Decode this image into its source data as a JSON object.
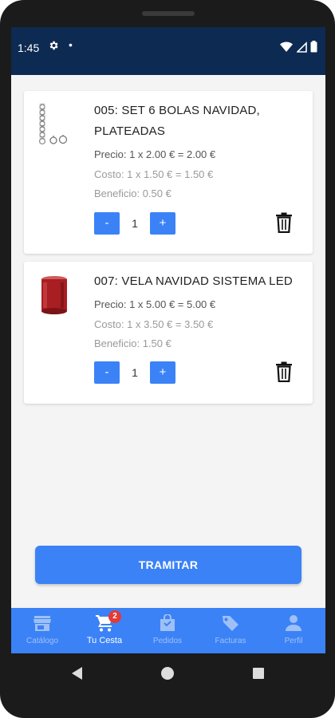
{
  "status_bar": {
    "time": "1:45",
    "settings_icon": "gear-icon",
    "notification_dot": "•",
    "wifi_icon": "wifi-icon",
    "signal_icon": "signal-icon",
    "battery_icon": "battery-icon",
    "bg_color": "#0d2a52"
  },
  "cart": {
    "items": [
      {
        "title": "005: SET 6 BOLAS NAVIDAD, PLATEADAS",
        "precio": "Precio: 1 x 2.00 € = 2.00 €",
        "costo": "Costo: 1 x 1.50 € = 1.50 €",
        "beneficio": "Beneficio: 0.50 €",
        "minus": "-",
        "quantity": "1",
        "plus": "+",
        "image_icon": "ornament-balls-image",
        "delete_icon": "trash-icon"
      },
      {
        "title": "007: VELA NAVIDAD SISTEMA LED",
        "precio": "Precio: 1 x 5.00 € = 5.00 €",
        "costo": "Costo: 1 x 3.50 € = 3.50 €",
        "beneficio": "Beneficio: 1.50 €",
        "minus": "-",
        "quantity": "1",
        "plus": "+",
        "image_icon": "red-candle-image",
        "delete_icon": "trash-icon"
      }
    ],
    "checkout_label": "TRAMITAR"
  },
  "bottom_nav": {
    "items": [
      {
        "label": "Catálogo",
        "icon": "store-icon",
        "active": false
      },
      {
        "label": "Tu Cesta",
        "icon": "cart-icon",
        "active": true,
        "badge": "2"
      },
      {
        "label": "Pedidos",
        "icon": "bag-icon",
        "active": false
      },
      {
        "label": "Facturas",
        "icon": "tag-icon",
        "active": false
      },
      {
        "label": "Perfil",
        "icon": "person-icon",
        "active": false
      }
    ]
  },
  "colors": {
    "accent": "#3b82f6",
    "badge": "#e53935",
    "header": "#0d2a52"
  }
}
